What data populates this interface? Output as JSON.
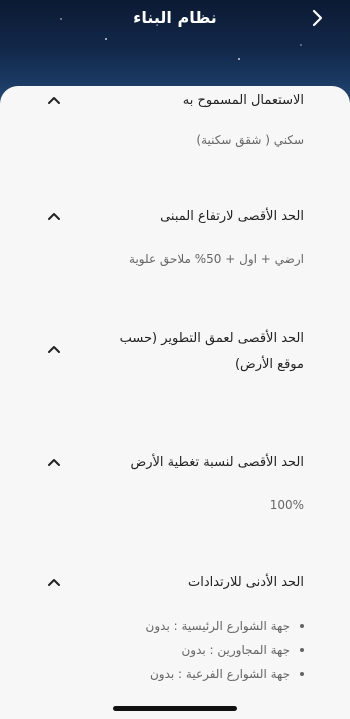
{
  "header": {
    "title": "نظام البناء"
  },
  "sections": [
    {
      "title": "الاستعمال المسموح به",
      "value": "سكني ( شقق سكنية)"
    },
    {
      "title": "الحد الأقصى لارتفاع المبنى",
      "value": "ارضي + اول + 50% ملاحق علوية"
    },
    {
      "title": "الحد الأقصى لعمق التطوير (حسب موقع الأرض)",
      "value": ""
    },
    {
      "title": "الحد الأقصى لنسبة تغطية الأرض",
      "value": "100%"
    },
    {
      "title": "الحد الأدنى للارتدادات",
      "bullets": [
        "جهة الشوارع الرئيسية : بدون",
        "جهة المجاورين : بدون",
        "جهة الشوارع الفرعية : بدون"
      ]
    }
  ],
  "icons": {
    "back": "chevron-right-icon",
    "collapse": "chevron-up-icon"
  }
}
